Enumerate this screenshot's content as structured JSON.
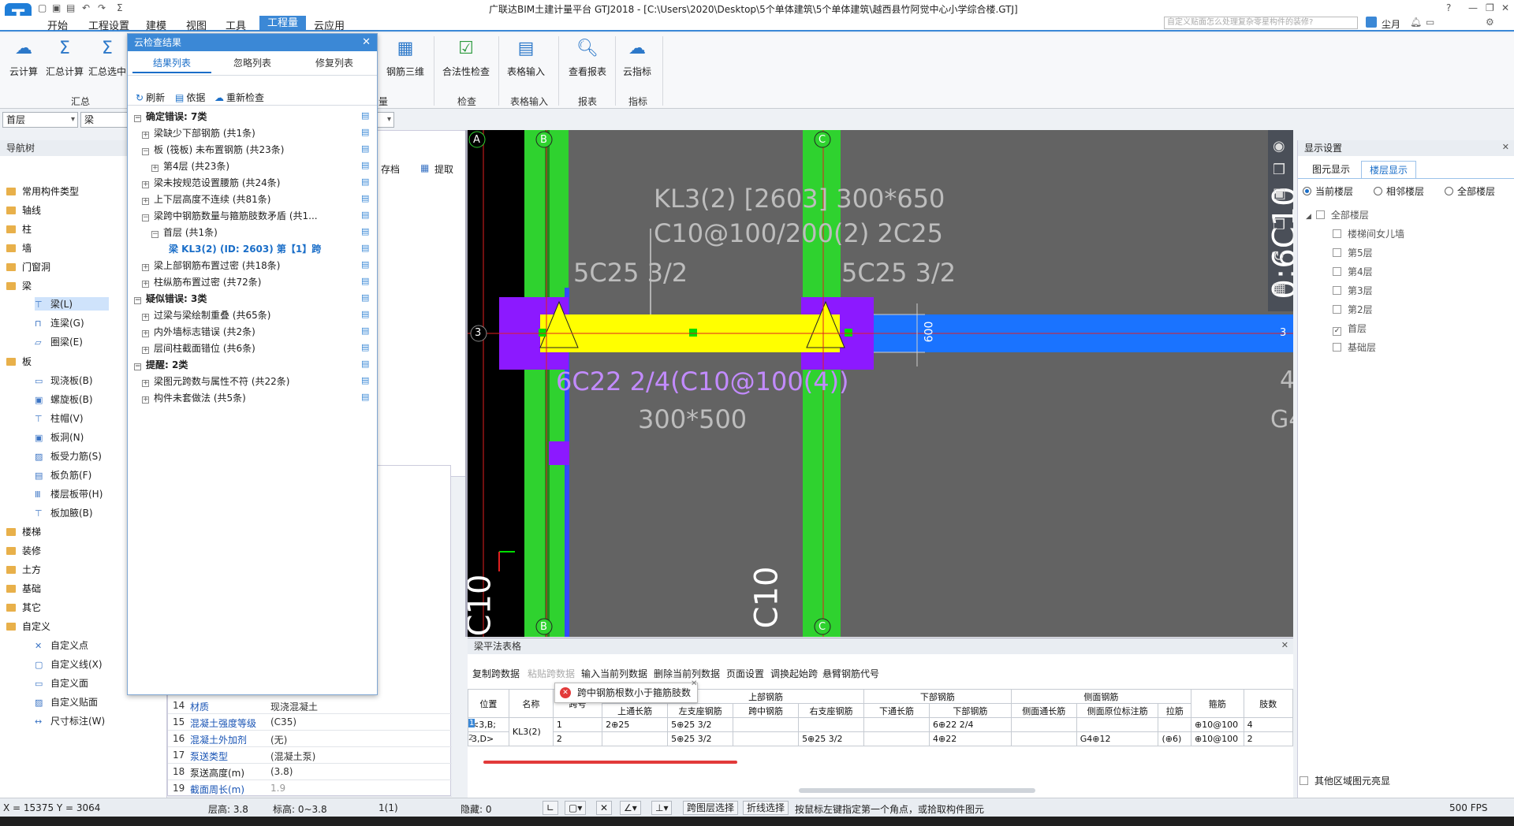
{
  "app": {
    "title": "广联达BIM土建计量平台 GTJ2018 - [C:\\Users\\2020\\Desktop\\5个单体建筑\\5个单体建筑\\越西县竹阿觉中心小学综合楼.GTJ]",
    "search_placeholder": "自定义贴面怎么处理复杂零星构件的装修?",
    "user": "尘月"
  },
  "menu": [
    "开始",
    "工程设置",
    "建模",
    "视图",
    "工具",
    "工程量",
    "云应用"
  ],
  "ribbon": {
    "buttons": [
      "云计算",
      "汇总计算",
      "汇总选中",
      "钢筋三维",
      "合法性检查",
      "表格输入",
      "查看报表",
      "云指标"
    ],
    "groups": [
      "汇总",
      "检查",
      "表格输入",
      "报表",
      "指标"
    ],
    "group_partial": "量"
  },
  "selectors": {
    "floor": "首层",
    "type": "梁"
  },
  "nav": {
    "title": "导航树",
    "items": [
      "常用构件类型",
      "轴线",
      "柱",
      "墙",
      "门窗洞",
      "梁",
      "板",
      "楼梯",
      "装修",
      "土方",
      "基础",
      "其它",
      "自定义"
    ],
    "beam_sub": [
      "梁(L)",
      "连梁(G)",
      "圈梁(E)"
    ],
    "slab_sub": [
      "现浇板(B)",
      "螺旋板(B)",
      "柱帽(V)",
      "板洞(N)",
      "板受力筋(S)",
      "板负筋(F)",
      "楼层板带(H)",
      "板加腋(B)"
    ],
    "custom_sub": [
      "自定义点",
      "自定义线(X)",
      "自定义面",
      "自定义贴面",
      "尺寸标注(W)"
    ]
  },
  "props": {
    "toolbar": [
      "存档",
      "提取"
    ],
    "rows": [
      {
        "n": "14",
        "k": "材质",
        "v": "现浇混凝土",
        "blue": true
      },
      {
        "n": "15",
        "k": "混凝土强度等级",
        "v": "(C35)",
        "blue": true
      },
      {
        "n": "16",
        "k": "混凝土外加剂",
        "v": "(无)",
        "blue": true
      },
      {
        "n": "17",
        "k": "泵送类型",
        "v": "(混凝土泵)",
        "blue": true
      },
      {
        "n": "18",
        "k": "泵送高度(m)",
        "v": "(3.8)",
        "blue": false
      },
      {
        "n": "19",
        "k": "截面周长(m)",
        "v": "1.9",
        "blue": true
      }
    ]
  },
  "cloud": {
    "title": "云检查结果",
    "tabs": [
      "结果列表",
      "忽略列表",
      "修复列表"
    ],
    "tools": [
      "刷新",
      "依据",
      "重新检查"
    ],
    "lines": [
      {
        "t": "确定错误: 7类",
        "b": "−",
        "cls": "bold",
        "indent": 0
      },
      {
        "t": "梁缺少下部钢筋 (共1条)",
        "b": "+",
        "cls": "",
        "indent": 1
      },
      {
        "t": "板 (筏板) 未布置钢筋 (共23条)",
        "b": "−",
        "cls": "",
        "indent": 1
      },
      {
        "t": "第4层 (共23条)",
        "b": "+",
        "cls": "",
        "indent": 2
      },
      {
        "t": "梁未按规范设置腰筋 (共24条)",
        "b": "+",
        "cls": "",
        "indent": 1
      },
      {
        "t": "上下层高度不连续 (共81条)",
        "b": "+",
        "cls": "",
        "indent": 1
      },
      {
        "t": "梁跨中钢筋数量与箍筋肢数矛盾 (共1...",
        "b": "−",
        "cls": "",
        "indent": 1
      },
      {
        "t": "首层 (共1条)",
        "b": "−",
        "cls": "",
        "indent": 2
      },
      {
        "t": "梁 KL3(2) (ID: 2603) 第【1】跨",
        "b": "",
        "cls": "link",
        "indent": 3
      },
      {
        "t": "梁上部钢筋布置过密 (共18条)",
        "b": "+",
        "cls": "",
        "indent": 1
      },
      {
        "t": "柱纵筋布置过密 (共72条)",
        "b": "+",
        "cls": "",
        "indent": 1
      },
      {
        "t": "疑似错误: 3类",
        "b": "−",
        "cls": "bold",
        "indent": 0
      },
      {
        "t": "过梁与梁绘制重叠 (共65条)",
        "b": "+",
        "cls": "",
        "indent": 1
      },
      {
        "t": "内外墙标志错误 (共2条)",
        "b": "+",
        "cls": "",
        "indent": 1
      },
      {
        "t": "层间柱截面错位 (共6条)",
        "b": "+",
        "cls": "",
        "indent": 1
      },
      {
        "t": "提醒: 2类",
        "b": "−",
        "cls": "bold",
        "indent": 0
      },
      {
        "t": "梁图元跨数与属性不符 (共22条)",
        "b": "+",
        "cls": "",
        "indent": 1
      },
      {
        "t": "构件未套做法 (共5条)",
        "b": "+",
        "cls": "",
        "indent": 1
      }
    ]
  },
  "canvas": {
    "axes": [
      "A",
      "B",
      "C",
      "3"
    ],
    "labels": [
      "KL3(2) [2603] 300*650",
      "C10@100/200(2) 2C25",
      "5C25 3/2",
      "5C25 3/2",
      "6C22 2/4(C10@100(4))",
      "300*500",
      "600",
      "0:6C10",
      "4",
      "G4",
      "C10",
      "C10"
    ]
  },
  "right": {
    "title": "显示设置",
    "tabs": [
      "图元显示",
      "楼层显示"
    ],
    "radios": [
      "当前楼层",
      "相邻楼层",
      "全部楼层"
    ],
    "floors": [
      "全部楼层",
      "楼梯间女儿墙",
      "第5层",
      "第4层",
      "第3层",
      "第2层",
      "首层",
      "基础层"
    ],
    "bottom": "其他区域图元亮显"
  },
  "table": {
    "title": "梁平法表格",
    "toolbar": [
      "复制跨数据",
      "粘贴跨数据",
      "输入当前列数据",
      "删除当前列数据",
      "页面设置",
      "调换起始跨",
      "悬臂钢筋代号"
    ],
    "headers_top": [
      "位置",
      "名称",
      "跨号",
      "",
      "上部钢筋",
      "下部钢筋",
      "侧面钢筋",
      "箍筋",
      "肢数"
    ],
    "headers": [
      "",
      "",
      "",
      "上通长筋",
      "左支座钢筋",
      "跨中钢筋",
      "右支座钢筋",
      "下通长筋",
      "下部钢筋",
      "侧面通长筋",
      "侧面原位标注筋",
      "拉筋",
      "",
      ""
    ],
    "rows": [
      [
        "<3,B;",
        "KL3(2)",
        "1",
        "2⊕25",
        "5⊕25 3/2",
        "",
        "",
        "",
        "6⊕22 2/4",
        "",
        "",
        "",
        "⊕10@100",
        "4"
      ],
      [
        "3,D>",
        "",
        "2",
        "",
        "5⊕25 3/2",
        "",
        "5⊕25 3/2",
        "",
        "4⊕22",
        "",
        "G4⊕12",
        "(⊕6)",
        "⊕10@100",
        "2"
      ]
    ],
    "row_nums": [
      "1",
      "2"
    ],
    "tooltip": "跨中钢筋根数小于箍筋肢数"
  },
  "status": {
    "coords": "X = 15375 Y = 3064",
    "floor_h": "层高:  3.8",
    "elev": "标高:  0~3.8",
    "sel": "1(1)",
    "hidden": "隐藏:  0",
    "btns": [
      "跨图层选择",
      "折线选择"
    ],
    "hint": "按鼠标左键指定第一个角点，或拾取构件图元",
    "fps": "500 FPS"
  }
}
